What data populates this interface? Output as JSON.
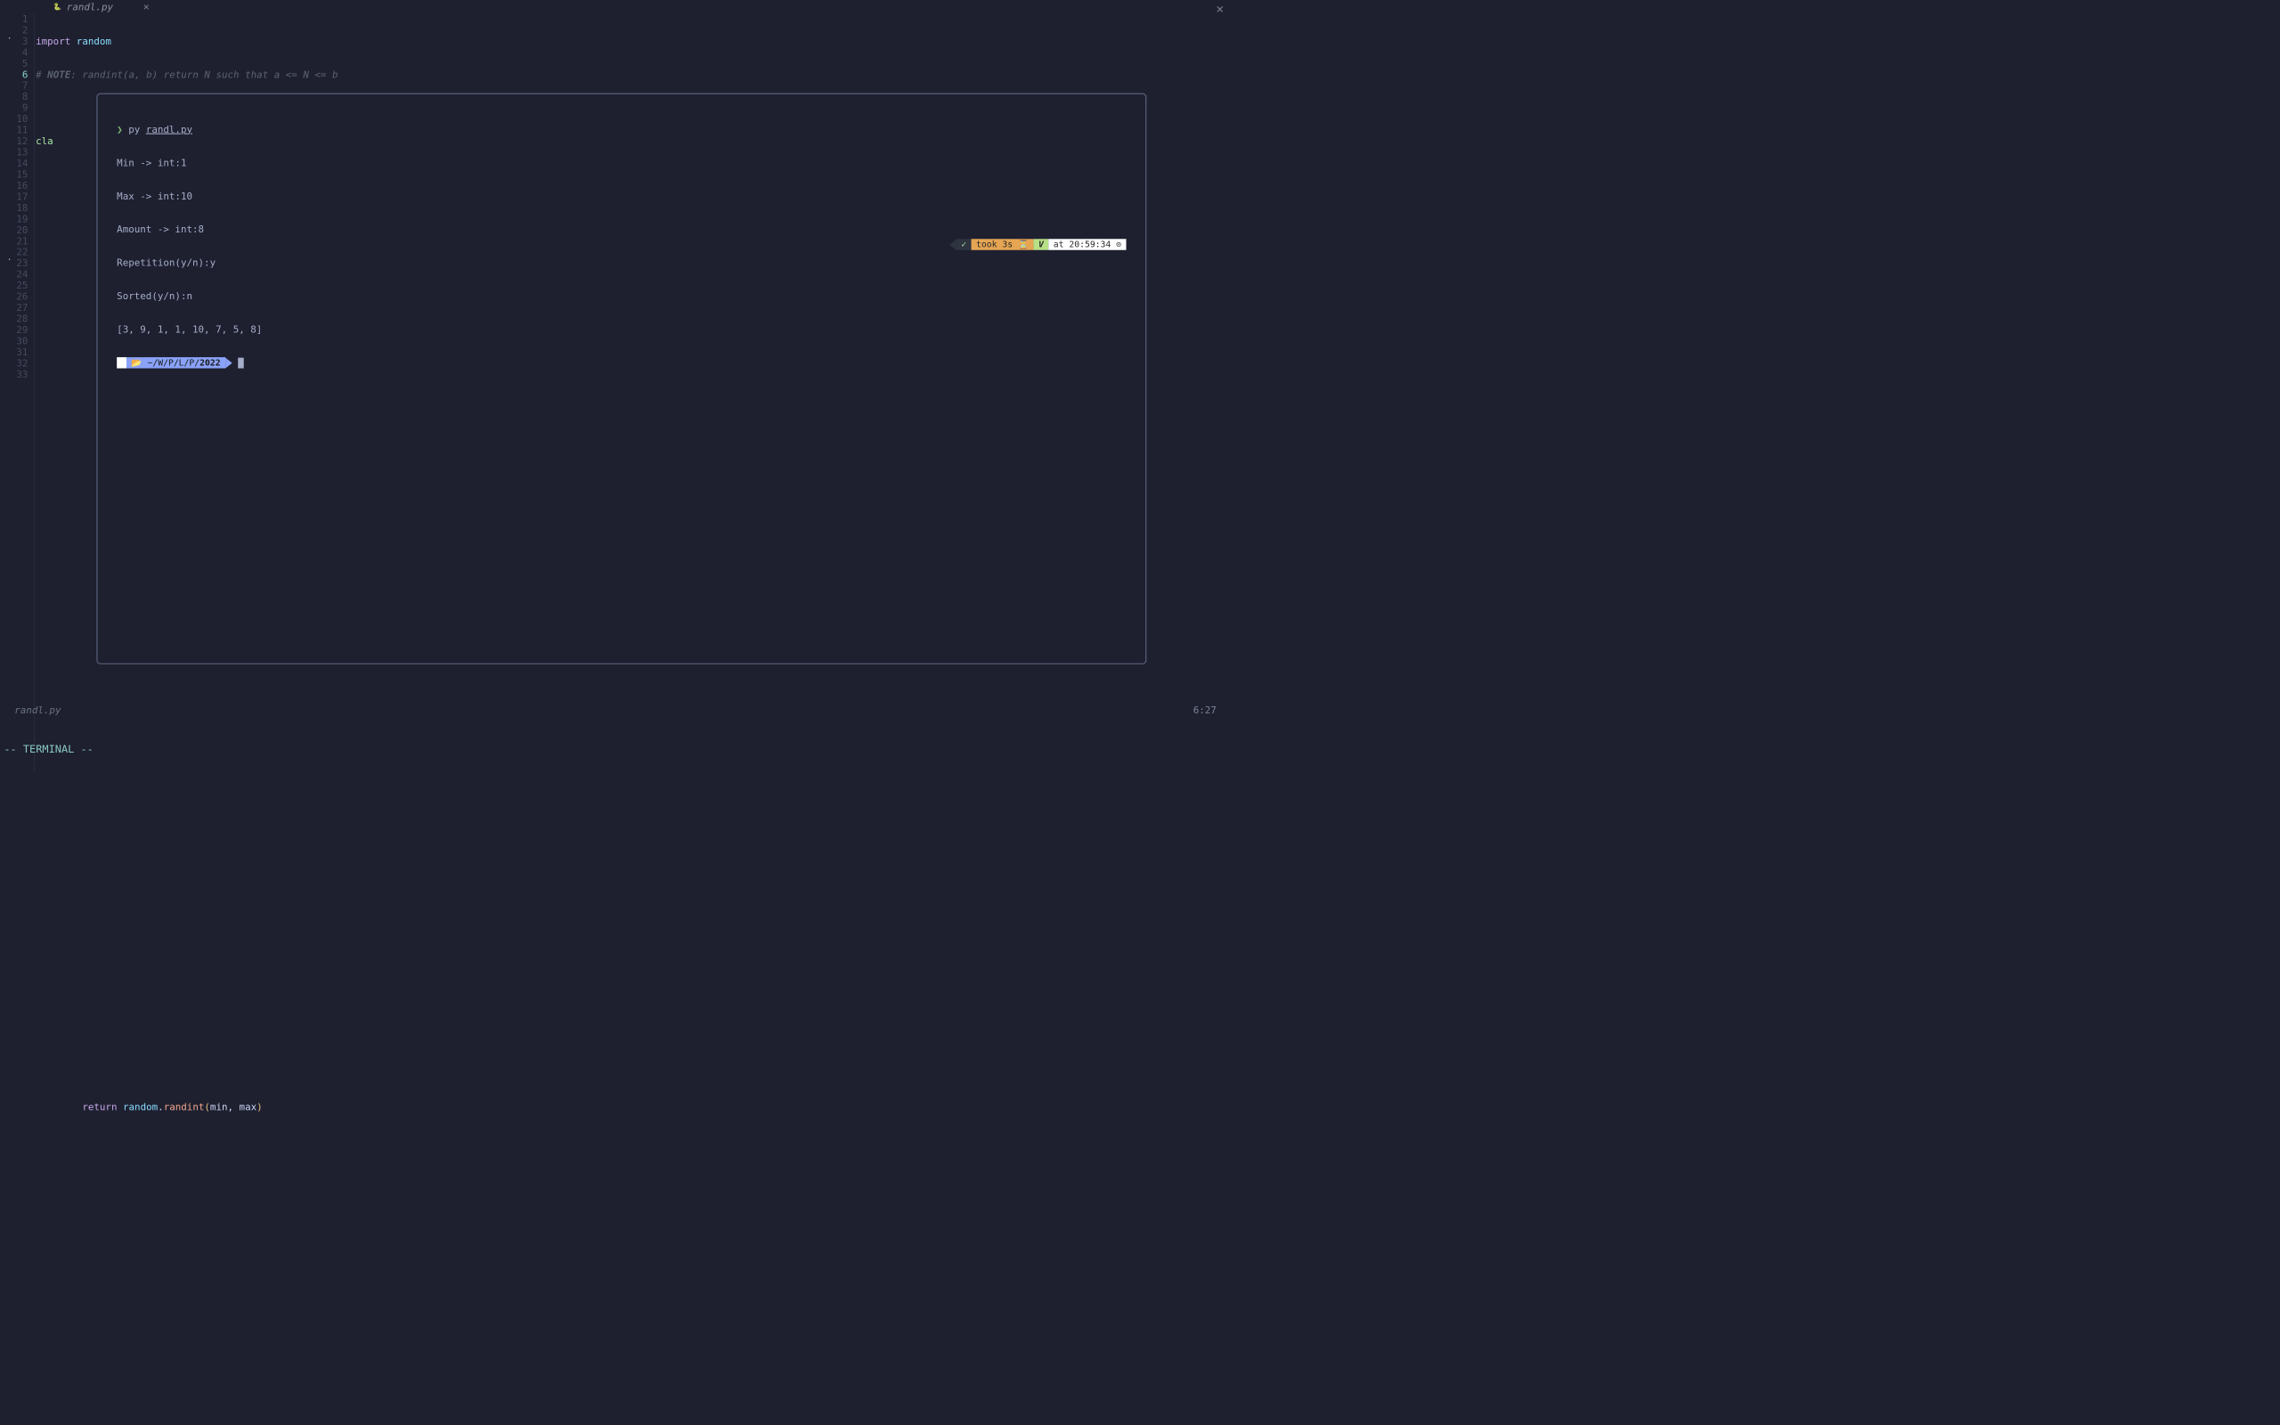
{
  "tab": {
    "filename": "randl.py",
    "close_glyph": "×",
    "global_close_glyph": "✕"
  },
  "gutter": {
    "lines": [
      "1",
      "2",
      "3",
      "4",
      "5",
      "6",
      "7",
      "8",
      "9",
      "10",
      "11",
      "12",
      "13",
      "14",
      "15",
      "16",
      "17",
      "18",
      "19",
      "20",
      "21",
      "22",
      "23",
      "24",
      "25",
      "26",
      "27",
      "28",
      "29",
      "30",
      "31",
      "32",
      "33"
    ],
    "current": 6
  },
  "code": {
    "l1_import": "import",
    "l1_random": "random",
    "l2_comment_prefix": "# ",
    "l2_note": "NOTE",
    "l2_rest": ": randint(a, b) return N such that a <= N <= b",
    "l4_cla": "cla",
    "l33_indent": "        ",
    "l33_return": "return",
    "l33_space": " ",
    "l33_random": "random",
    "l33_dot": ".",
    "l33_fn": "randint",
    "l33_open": "(",
    "l33_args": "min, max",
    "l33_close": ")"
  },
  "terminal": {
    "prompt_arrow": "❯",
    "cmd_py": "py ",
    "cmd_file": "randl.py",
    "out1": "Min -> int:1",
    "out2": "Max -> int:10",
    "out3": "Amount -> int:8",
    "out4": "Repetition(y/n):y",
    "out5": "Sorted(y/n):n",
    "out6": "[3, 9, 1, 1, 10, 7, 5, 8]",
    "path_prefix": "~/W/P/L/P/",
    "path_highlight": "2022",
    "apple_glyph": "",
    "folder_glyph": "📁"
  },
  "right_status": {
    "check": "✓",
    "took": "took 3s ",
    "hourglass": "⏳",
    "v": "V",
    "time_prefix": "at ",
    "time": "20:59:34",
    "clock": " ⊙"
  },
  "footer": {
    "filename": "randl.py",
    "cursor_pos": "6:27",
    "mode": "-- TERMINAL --"
  }
}
